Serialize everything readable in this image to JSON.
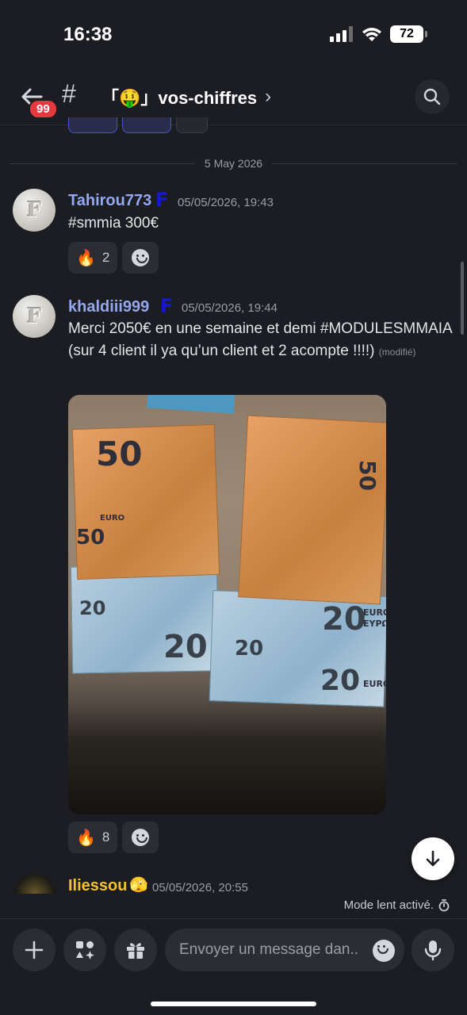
{
  "status_bar": {
    "time": "16:38",
    "battery": "72"
  },
  "header": {
    "unread_badge": "99",
    "channel_hash": "#",
    "channel_name": "「🤑」vos-chiffres",
    "chevron": "›"
  },
  "date_separator": "5 May 2026",
  "messages": [
    {
      "avatar_letter": "F",
      "username": "Tahirou773",
      "role_icon": "F",
      "timestamp": "05/05/2026, 19:43",
      "text": "#smmia 300€",
      "reactions": [
        {
          "emoji": "🔥",
          "count": "2"
        }
      ]
    },
    {
      "avatar_letter": "F",
      "username": "khaldiii999",
      "role_icon": "F",
      "timestamp": "05/05/2026, 19:44",
      "text": "Merci 2050€ en une semaine et demi #MODULESMMAIA (sur 4 client il ya qu’un client et 2 acompte !!!!)",
      "edited": "(modifié)",
      "reactions": [
        {
          "emoji": "🔥",
          "count": "8"
        }
      ]
    },
    {
      "username": "Iliessou",
      "role_icon": "🫣",
      "timestamp": "05/05/2026, 20:55"
    }
  ],
  "slow_mode": "Mode lent activé.",
  "composer": {
    "placeholder": "Envoyer un message dan.."
  },
  "photo_notes": {
    "fifty": "50",
    "twenty": "20",
    "euro": "EURO",
    "evro": "EYPΩ"
  },
  "colors": {
    "background": "#1c1d22",
    "username": "#93a8ee",
    "iliessou": "#f2c230",
    "badge": "#e5393f",
    "role": "#1616d8"
  }
}
